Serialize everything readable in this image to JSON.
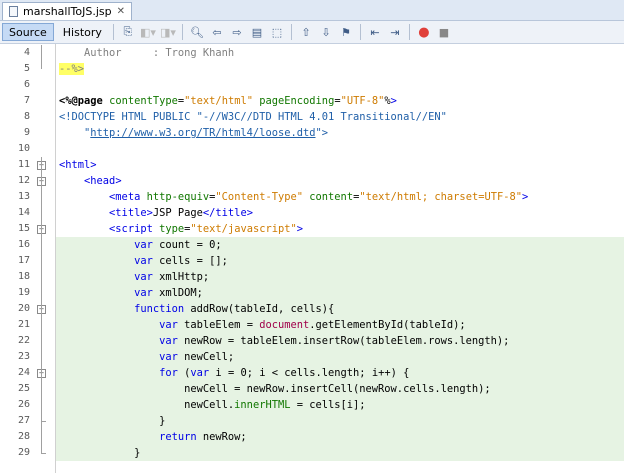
{
  "tab": {
    "filename": "marshallToJS.jsp",
    "close": "✕"
  },
  "views": {
    "source": "Source",
    "history": "History"
  },
  "lines": [
    {
      "n": "4",
      "t": "    Author     : Trong Khanh"
    },
    {
      "n": "5",
      "t": "--%>"
    },
    {
      "n": "6",
      "t": ""
    },
    {
      "n": "7",
      "t": "<%@page contentType=\"text/html\" pageEncoding=\"UTF-8\"%>"
    },
    {
      "n": "8",
      "t": "<!DOCTYPE HTML PUBLIC \"-//W3C//DTD HTML 4.01 Transitional//EN\""
    },
    {
      "n": "9",
      "t": "    \"http://www.w3.org/TR/html4/loose.dtd\">"
    },
    {
      "n": "10",
      "t": ""
    },
    {
      "n": "11",
      "t": "<html>"
    },
    {
      "n": "12",
      "t": "    <head>"
    },
    {
      "n": "13",
      "t": "        <meta http-equiv=\"Content-Type\" content=\"text/html; charset=UTF-8\">"
    },
    {
      "n": "14",
      "t": "        <title>JSP Page</title>"
    },
    {
      "n": "15",
      "t": "        <script type=\"text/javascript\">"
    },
    {
      "n": "16",
      "t": "            var count = 0;"
    },
    {
      "n": "17",
      "t": "            var cells = [];"
    },
    {
      "n": "18",
      "t": "            var xmlHttp;"
    },
    {
      "n": "19",
      "t": "            var xmlDOM;"
    },
    {
      "n": "20",
      "t": "            function addRow(tableId, cells){"
    },
    {
      "n": "21",
      "t": "                var tableElem = document.getElementById(tableId);"
    },
    {
      "n": "22",
      "t": "                var newRow = tableElem.insertRow(tableElem.rows.length);"
    },
    {
      "n": "23",
      "t": "                var newCell;"
    },
    {
      "n": "24",
      "t": "                for (var i = 0; i < cells.length; i++) {"
    },
    {
      "n": "25",
      "t": "                    newCell = newRow.insertCell(newRow.cells.length);"
    },
    {
      "n": "26",
      "t": "                    newCell.innerHTML = cells[i];"
    },
    {
      "n": "27",
      "t": "                }"
    },
    {
      "n": "28",
      "t": "                return newRow;"
    },
    {
      "n": "29",
      "t": "            }"
    }
  ]
}
